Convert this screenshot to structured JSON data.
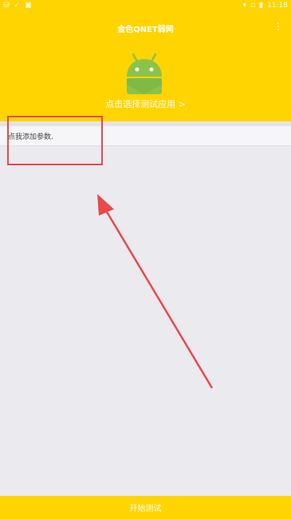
{
  "status_bar": {
    "time": "11:18",
    "left_icons": [
      "signal-icon",
      "check-icon",
      "notification-icon"
    ],
    "right_icons": [
      "wifi-icon",
      "sim-icon",
      "battery-icon"
    ]
  },
  "header": {
    "title": "金色QNET弱网",
    "menu_icon": "more-vert-icon",
    "select_app_label": "点击选择测试应用 >"
  },
  "params": {
    "add_param_text": "点我添加参数."
  },
  "footer": {
    "start_label": "开始测试"
  },
  "colors": {
    "primary": "#ffd400",
    "background": "#ebeaef",
    "annotation": "#e8494d",
    "android_green": "#8bc34a"
  }
}
